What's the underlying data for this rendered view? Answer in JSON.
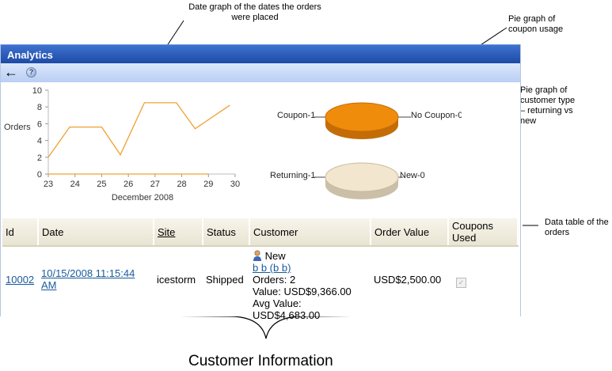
{
  "annotations": {
    "date_graph": "Date graph of the dates the orders were placed",
    "coupon_pie": "Pie graph of coupon usage",
    "customer_pie": "Pie graph of customer type – returning vs new",
    "data_table": "Data table of the orders",
    "customer_info": "Customer Information"
  },
  "window": {
    "title": "Analytics"
  },
  "toolbar": {
    "back_glyph": "←",
    "help_glyph": "?"
  },
  "chart_data": {
    "type": "line",
    "x": [
      23,
      24,
      25,
      26,
      27,
      28,
      29,
      30
    ],
    "xticks": [
      "23",
      "24",
      "25",
      "26",
      "27",
      "28",
      "29",
      "30"
    ],
    "yticks": [
      "0",
      "2",
      "4",
      "6",
      "8",
      "10"
    ],
    "ylim": [
      0,
      10
    ],
    "xlim": [
      23,
      30
    ],
    "xlabel": "December 2008",
    "ylabel": "Orders",
    "series": [
      {
        "x": [
          23,
          23.8,
          25,
          25.7,
          26.6,
          27.8,
          28.5,
          29.8
        ],
        "values": [
          2,
          5.6,
          5.6,
          2.3,
          8.5,
          8.5,
          5.4,
          8.2
        ],
        "color": "#f0a030"
      },
      {
        "x": [
          23,
          29
        ],
        "values": [
          0,
          0
        ],
        "color": "#f0a030"
      }
    ]
  },
  "pies": {
    "coupon": {
      "left_label": "Coupon-1",
      "right_label": "No Coupon-0",
      "color": "#f08c0c"
    },
    "customer": {
      "left_label": "Returning-1",
      "right_label": "New-0",
      "color": "#f2e6cf"
    }
  },
  "table": {
    "headers": {
      "id": "Id",
      "date": "Date",
      "site": "Site",
      "status": "Status",
      "customer": "Customer",
      "order_value": "Order Value",
      "coupons": "Coupons Used"
    },
    "row": {
      "id": "10002",
      "date": "10/15/2008 11:15:44 AM",
      "site": "icestorm",
      "status": "Shipped",
      "customer_type": "New",
      "customer_name": "b b (b b)",
      "orders": "Orders: 2",
      "value": "Value: USD$9,366.00",
      "avg_value_label": "Avg Value:",
      "avg_value": "USD$4,683.00",
      "order_value": "USD$2,500.00",
      "coupon_check": "✓"
    }
  }
}
